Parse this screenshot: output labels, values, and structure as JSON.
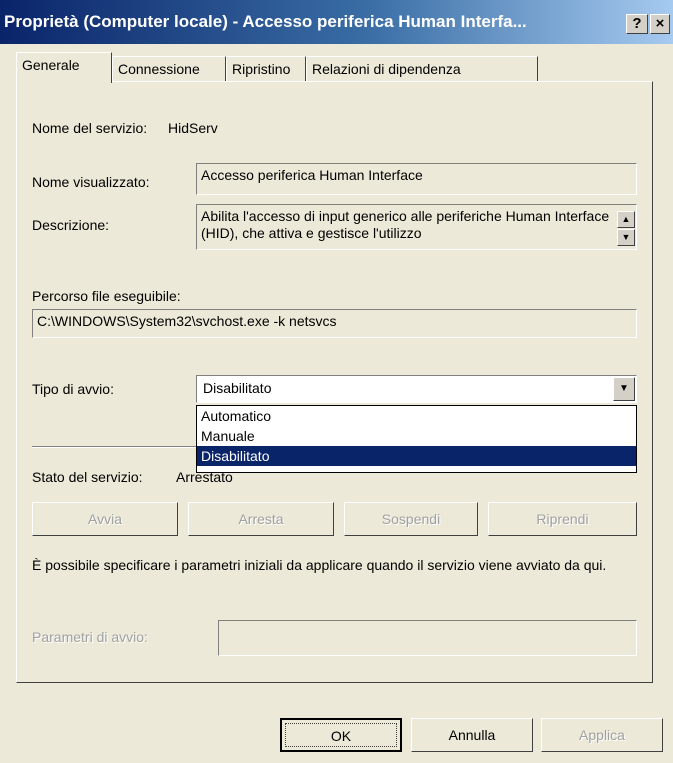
{
  "window": {
    "title": "Proprietà (Computer locale) - Accesso periferica Human Interfa...",
    "help_label": "?",
    "close_label": "×"
  },
  "tabs": [
    {
      "label": "Generale",
      "active": true
    },
    {
      "label": "Connessione",
      "active": false
    },
    {
      "label": "Ripristino",
      "active": false
    },
    {
      "label": "Relazioni di dipendenza",
      "active": false
    }
  ],
  "general": {
    "service_name_label": "Nome del servizio:",
    "service_name_value": "HidServ",
    "display_name_label": "Nome visualizzato:",
    "display_name_value": "Accesso periferica Human Interface",
    "description_label": "Descrizione:",
    "description_value": "Abilita l'accesso di input generico alle periferiche Human Interface (HID), che attiva e gestisce l'utilizzo",
    "exe_path_label": "Percorso file eseguibile:",
    "exe_path_value": "C:\\WINDOWS\\System32\\svchost.exe -k netsvcs",
    "startup_type_label": "Tipo di avvio:",
    "startup_type_value": "Disabilitato",
    "startup_options": [
      "Automatico",
      "Manuale",
      "Disabilitato"
    ],
    "startup_selected_index": 2,
    "service_status_label": "Stato del servizio:",
    "service_status_value": "Arrestato",
    "buttons": {
      "start": "Avvia",
      "stop": "Arresta",
      "pause": "Sospendi",
      "resume": "Riprendi"
    },
    "params_hint": "È possibile specificare i parametri iniziali da applicare quando il servizio viene avviato da qui.",
    "params_label": "Parametri di avvio:",
    "params_value": ""
  },
  "footer": {
    "ok": "OK",
    "cancel": "Annulla",
    "apply": "Applica"
  }
}
